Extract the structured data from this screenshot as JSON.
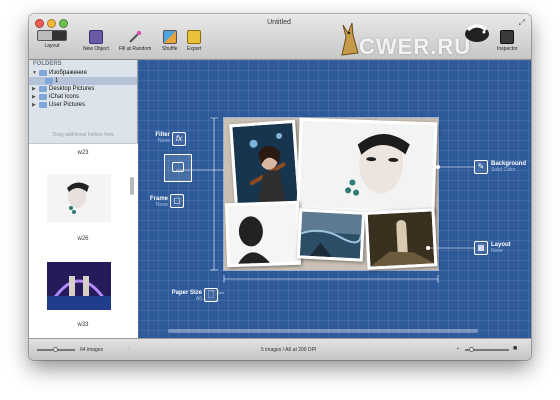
{
  "window": {
    "title": "Untitled"
  },
  "toolbar": {
    "layout": "Layout",
    "new_object": "New Object",
    "fill_at_random": "Fill at Random",
    "shuffle": "Shuffle",
    "export": "Export",
    "inspector": "Inspector"
  },
  "watermark": "CWER.RU",
  "sidebar": {
    "header": "FOLDERS",
    "items": [
      {
        "label": "Изображения",
        "expanded": true,
        "selected": false
      },
      {
        "label": "1",
        "expanded": false,
        "selected": true
      },
      {
        "label": "Desktop Pictures",
        "expanded": false,
        "selected": false
      },
      {
        "label": "iChat Icons",
        "expanded": false,
        "selected": false
      },
      {
        "label": "User Pictures",
        "expanded": false,
        "selected": false
      }
    ],
    "drag_hint": "Drag additional folders here"
  },
  "thumbnails": [
    {
      "label": "w23"
    },
    {
      "label": "w26"
    },
    {
      "label": "w33"
    }
  ],
  "canvas": {
    "filter": {
      "title": "Filter",
      "value": "None"
    },
    "frame": {
      "title": "Frame",
      "value": "None"
    },
    "paper_size": {
      "title": "Paper Size",
      "value": "A6"
    },
    "background": {
      "title": "Background",
      "value": "Solid Color"
    },
    "layout": {
      "title": "Layout",
      "value": "None"
    }
  },
  "status": {
    "image_count": "64 images",
    "summary": "5 images / A6 at 200 DPI"
  },
  "colors": {
    "canvas_bg": "#2f5a9a",
    "sidebar_bg": "#dde3ea",
    "selection": "#b4c3d7"
  }
}
